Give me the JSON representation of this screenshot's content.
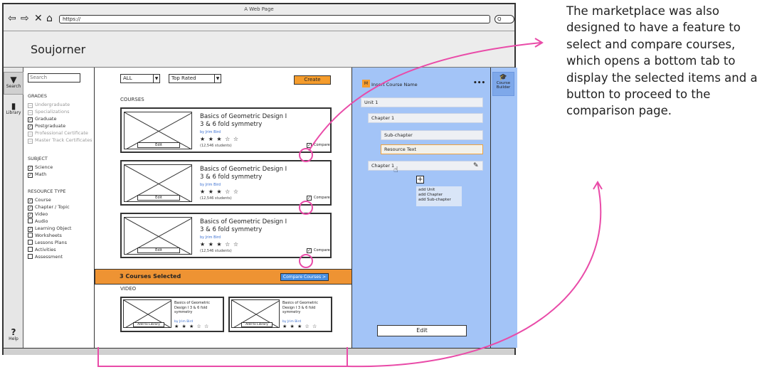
{
  "browser": {
    "window_title": "A Web Page",
    "url": "https://",
    "search_placeholder": "Q"
  },
  "app": {
    "title": "Soujorner"
  },
  "leftbar": {
    "items": [
      {
        "label": "Search",
        "icon": "filter-icon"
      },
      {
        "label": "Library",
        "icon": "book-icon"
      },
      {
        "label": "Help",
        "icon": "help-icon"
      }
    ]
  },
  "filters": {
    "search_placeholder": "Search",
    "grades_heading": "GRADES",
    "grades": [
      {
        "label": "Undergraduate",
        "checked": false,
        "disabled": true
      },
      {
        "label": "Specializations",
        "checked": false,
        "disabled": true
      },
      {
        "label": "Graduate",
        "checked": true,
        "disabled": false
      },
      {
        "label": "Postgraduate",
        "checked": true,
        "disabled": false
      },
      {
        "label": "Professional Certificate",
        "checked": false,
        "disabled": true
      },
      {
        "label": "Master Track Certificates",
        "checked": false,
        "disabled": true
      }
    ],
    "subject_heading": "SUBJECT",
    "subjects": [
      {
        "label": "Science",
        "checked": true
      },
      {
        "label": "Math",
        "checked": true
      }
    ],
    "resource_heading": "RESOURCE TYPE",
    "resources": [
      {
        "label": "Course",
        "checked": true
      },
      {
        "label": "Chapter / Topic",
        "checked": true
      },
      {
        "label": "Video",
        "checked": true
      },
      {
        "label": "Audio",
        "checked": false
      },
      {
        "label": "Learning Object",
        "checked": true
      },
      {
        "label": "Worksheets",
        "checked": false
      },
      {
        "label": "Lessons Plans",
        "checked": false
      },
      {
        "label": "Activities",
        "checked": false
      },
      {
        "label": "Assessment",
        "checked": false
      }
    ]
  },
  "main": {
    "filter_select": "ALL",
    "sort_select": "Top Rated",
    "create_label": "Create",
    "courses_heading": "COURSES",
    "courses": [
      {
        "title": "Basics of Geometric Design I 3 & 6 fold symmetry",
        "author": "by Jrim Bird",
        "stars": "★ ★ ★ ☆ ☆",
        "students": "(12,546 students)",
        "edit": "Edit",
        "compare": "Compare",
        "compared": true
      },
      {
        "title": "Basics of Geometric Design I 3 & 6 fold symmetry",
        "author": "by Jrim Bird",
        "stars": "★ ★ ★ ☆ ☆",
        "students": "(12,546 students)",
        "edit": "Edit",
        "compare": "Compare",
        "compared": true
      },
      {
        "title": "Basics of Geometric Design I 3 & 6 fold symmetry",
        "author": "by Jrim Bird",
        "stars": "★ ★ ★ ☆ ☆",
        "students": "(12,546 students)",
        "edit": "Edit",
        "compare": "Compare",
        "compared": true
      }
    ],
    "video_heading": "VIDEO",
    "videos": [
      {
        "title": "Basics of Geometric Design I 3 & 6 fold symmetry",
        "author": "by Jrim Bird",
        "stars": "★ ★ ★ ☆ ☆",
        "add": "Add to Library"
      },
      {
        "title": "Basics of Geometric Design I 3 & 6 fold symmetry",
        "author": "by Jrim Bird",
        "stars": "★ ★ ★ ☆ ☆",
        "add": "Add to Library"
      }
    ],
    "compare_bar": {
      "count_label": "3 Courses Selected",
      "button_label": "Compare Courses >"
    }
  },
  "builder": {
    "course_name": "Insert Course Name",
    "more": "•••",
    "unit": "Unit 1",
    "chapter": "Chapter 1",
    "subchapter": "Sub-chapter",
    "resource_text": "Resource Text",
    "chapter_drag": "Chapter 1",
    "add_options": [
      "add Unit",
      "add Chapter",
      "add Sub-chapter"
    ],
    "edit_label": "Edit",
    "tab_label": "Course Builder"
  },
  "annotation": {
    "text": "The marketplace was also designed to have a feature to select and compare courses, which opens a bottom tab to display the selected items and a button to proceed to the comparison page."
  },
  "colors": {
    "accent_orange": "#ee9333",
    "builder_blue": "#a3c4f7",
    "annotation_pink": "#e94ba8",
    "button_blue": "#4a8fe0"
  }
}
